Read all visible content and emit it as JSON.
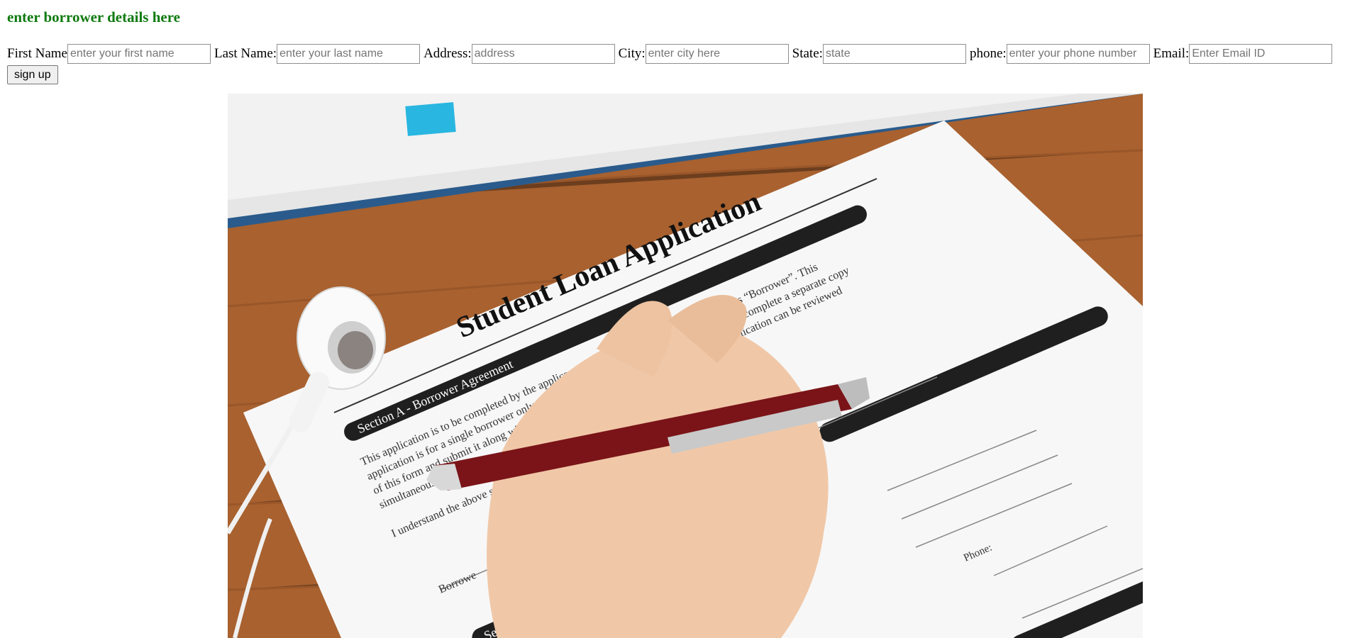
{
  "page": {
    "heading": "enter borrower details here"
  },
  "form": {
    "fields": [
      {
        "label": "First Name",
        "placeholder": "enter your first name",
        "value": ""
      },
      {
        "label": "Last Name:",
        "placeholder": "enter your last name",
        "value": ""
      },
      {
        "label": "Address:",
        "placeholder": "address",
        "value": ""
      },
      {
        "label": "City:",
        "placeholder": "enter city here",
        "value": ""
      },
      {
        "label": "State:",
        "placeholder": "state",
        "value": ""
      },
      {
        "label": "phone:",
        "placeholder": "enter your phone number",
        "value": ""
      },
      {
        "label": "Email:",
        "placeholder": "Enter Email ID",
        "value": ""
      }
    ],
    "submit_label": "sign up"
  },
  "photo": {
    "description_icon": "loan-application-photo",
    "doc_title": "Student Loan Application",
    "section_a": "Section A - Borrower Agreement",
    "para_1": "This application is to be completed by the applicant. Applicants must complete this form as “Borrower”. This",
    "para_2": "application is for a single borrower only. If the is a co-borrower for the account they must complete a separate copy",
    "para_3": "of this form and submit it along with this copy of the form so that the co-borrower's application can be reviewed",
    "para_4": "simultaneously.",
    "para_5": "I understand the above statement and will be applying",
    "borrower_label": "Borrowe",
    "phone_label": "Phone:",
    "section_b": "Section B"
  }
}
